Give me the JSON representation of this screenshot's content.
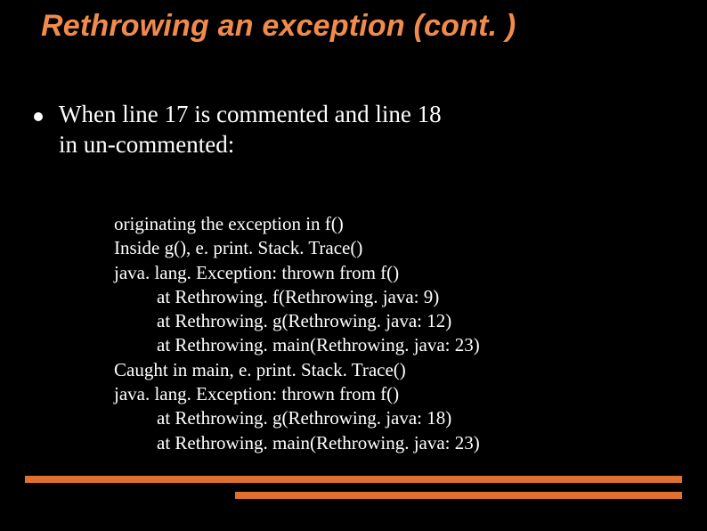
{
  "title": "Rethrowing an exception (cont. )",
  "bullet": {
    "line1": "When line 17 is commented and line 18",
    "line2": "in un-commented:"
  },
  "code": {
    "l1": "originating the exception in f()",
    "l2": "Inside g(), e. print. Stack. Trace()",
    "l3": "java. lang. Exception: thrown from f()",
    "l4": "at Rethrowing. f(Rethrowing. java: 9)",
    "l5": "at Rethrowing. g(Rethrowing. java: 12)",
    "l6": "at Rethrowing. main(Rethrowing. java: 23)",
    "l7": "Caught in main, e. print. Stack. Trace()",
    "l8": "java. lang. Exception: thrown from f()",
    "l9": "at Rethrowing. g(Rethrowing. java: 18)",
    "l10": "at Rethrowing. main(Rethrowing. java: 23)"
  }
}
